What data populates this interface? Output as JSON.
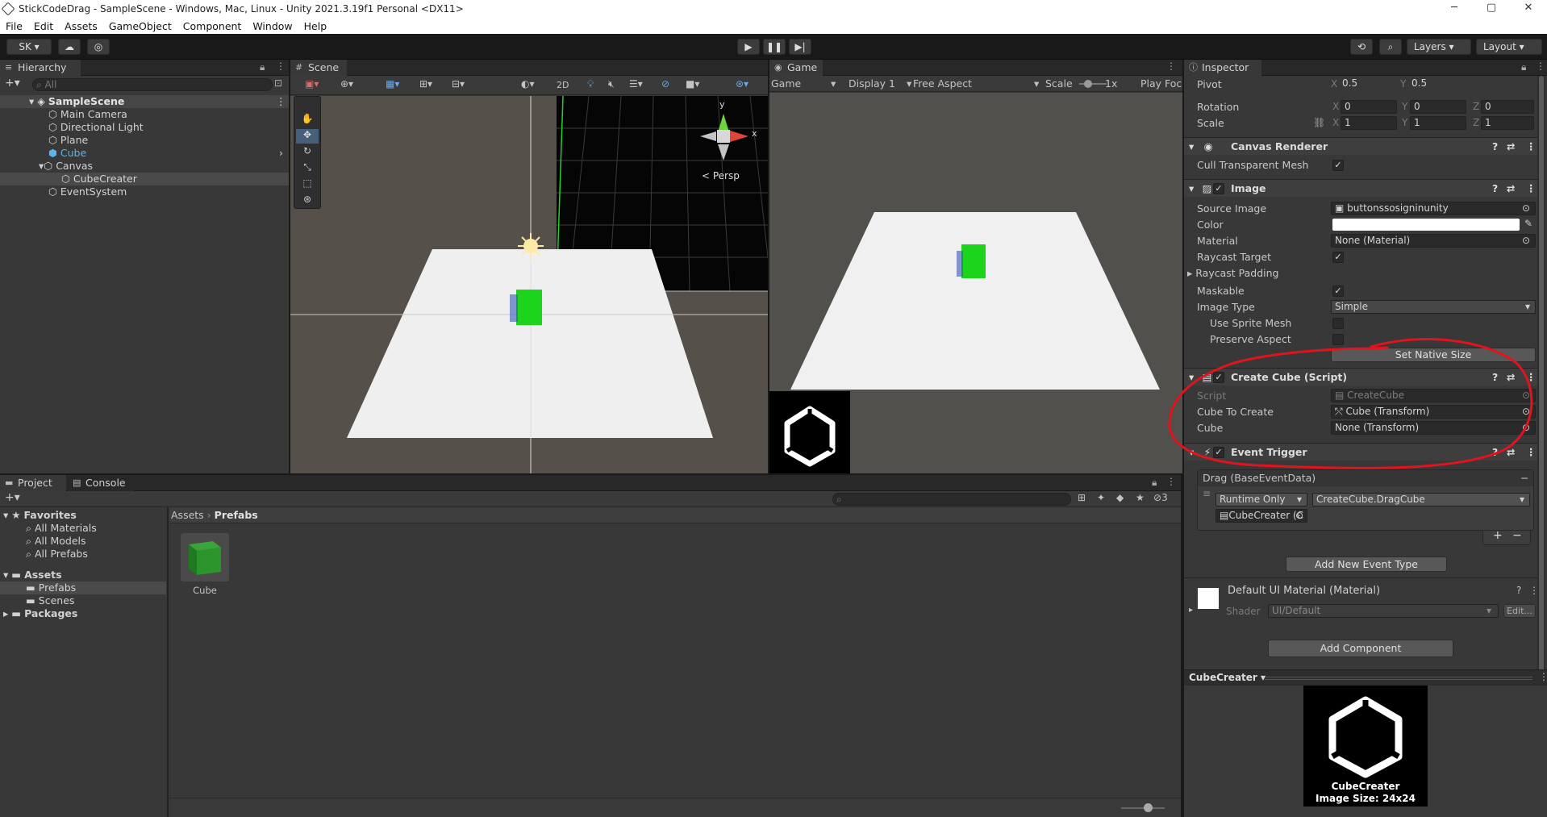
{
  "window": {
    "title": "StickCodeDrag - SampleScene - Windows, Mac, Linux - Unity 2021.3.19f1 Personal <DX11>",
    "minimize": "─",
    "maximize": "▢",
    "close": "✕"
  },
  "menu": [
    "File",
    "Edit",
    "Assets",
    "GameObject",
    "Component",
    "Window",
    "Help"
  ],
  "toolbar": {
    "account": "SK ▾",
    "layers": "Layers",
    "layout": "Layout"
  },
  "hierarchy": {
    "tab": "Hierarchy",
    "search_placeholder": "All",
    "scene": "SampleScene",
    "items": [
      "Main Camera",
      "Directional Light",
      "Plane",
      "Cube",
      "Canvas",
      "CubeCreater",
      "EventSystem"
    ]
  },
  "scene": {
    "tab": "Scene",
    "toggle_2d": "2D",
    "persp": "< Persp",
    "gizmo_y": "y",
    "gizmo_x": "x"
  },
  "game": {
    "tab": "Game",
    "mode": "Game",
    "display": "Display 1",
    "aspect": "Free Aspect",
    "scale_label": "Scale",
    "scale_value": "1x",
    "play_focused": "Play Foc"
  },
  "inspector": {
    "tab": "Inspector",
    "pivot": {
      "label": "Pivot",
      "x": "0.5",
      "y": "0.5"
    },
    "rotation": {
      "label": "Rotation",
      "x": "0",
      "y": "0",
      "z": "0"
    },
    "scale": {
      "label": "Scale",
      "x": "1",
      "y": "1",
      "z": "1"
    },
    "axis_x": "X",
    "axis_y": "Y",
    "axis_z": "Z",
    "canvas_renderer": {
      "title": "Canvas Renderer",
      "cull_label": "Cull Transparent Mesh"
    },
    "image": {
      "title": "Image",
      "source_label": "Source Image",
      "source_value": "buttonssosigninunity",
      "color_label": "Color",
      "material_label": "Material",
      "material_value": "None (Material)",
      "raycast_target": "Raycast Target",
      "raycast_padding": "Raycast Padding",
      "maskable": "Maskable",
      "image_type_label": "Image Type",
      "image_type_value": "Simple",
      "use_sprite_mesh": "Use Sprite Mesh",
      "preserve_aspect": "Preserve Aspect",
      "set_native_size": "Set Native Size"
    },
    "create_cube": {
      "title": "Create Cube (Script)",
      "script_label": "Script",
      "script_value": "CreateCube",
      "cube_to_create_label": "Cube To Create",
      "cube_to_create_value": "Cube (Transform)",
      "cube_label": "Cube",
      "cube_value": "None (Transform)"
    },
    "event_trigger": {
      "title": "Event Trigger",
      "drag_label": "Drag (BaseEventData)",
      "runtime": "Runtime Only",
      "function": "CreateCube.DragCube",
      "target": "CubeCreater (C",
      "add_event": "Add New Event Type",
      "plus": "+",
      "minus": "−"
    },
    "material": {
      "title": "Default UI Material (Material)",
      "shader_label": "Shader",
      "shader_value": "UI/Default",
      "edit": "Edit..."
    },
    "add_component": "Add Component",
    "preview": {
      "name": "CubeCreater",
      "caption_name": "CubeCreater",
      "caption_size": "Image Size: 24x24"
    }
  },
  "project": {
    "tab_project": "Project",
    "tab_console": "Console",
    "favorites": "Favorites",
    "fav_items": [
      "All Materials",
      "All Models",
      "All Prefabs"
    ],
    "assets": "Assets",
    "asset_items": [
      "Prefabs",
      "Scenes"
    ],
    "packages": "Packages",
    "breadcrumb_root": "Assets",
    "breadcrumb_current": "Prefabs",
    "asset_name": "Cube",
    "hidden_count": "3"
  },
  "colors": {
    "annotation": "#e0141e",
    "cube_green": "#1bd41b",
    "selected": "#2c5d87"
  }
}
